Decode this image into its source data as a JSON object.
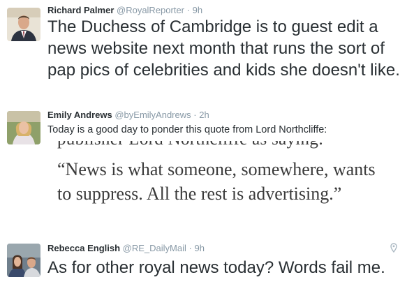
{
  "tweets": [
    {
      "name": "Richard Palmer",
      "handle": "@RoyalReporter",
      "time": "9h",
      "avatar_icon": "profile-photo",
      "text": "The Duchess of Cambridge is to guest edit a news website next month that runs the sort of pap pics of celebrities and kids she doesn't like."
    },
    {
      "name": "Emily Andrews",
      "handle": "@byEmilyAndrews",
      "time": "2h",
      "avatar_icon": "profile-photo",
      "text": "Today is a good day to ponder this quote from Lord Northcliffe:",
      "quote_image": {
        "cut_line": "publisher Lord Northcliffe as saying:",
        "quote": "“News is what someone, somewhere, wants to suppress. All the rest is advertising.”"
      }
    },
    {
      "name": "Rebecca English",
      "handle": "@RE_DailyMail",
      "time": "9h",
      "avatar_icon": "profile-photo",
      "text": "As for other royal news today? Words fail me.",
      "corner_icon": "location-pin-icon"
    }
  ],
  "separator": "·"
}
